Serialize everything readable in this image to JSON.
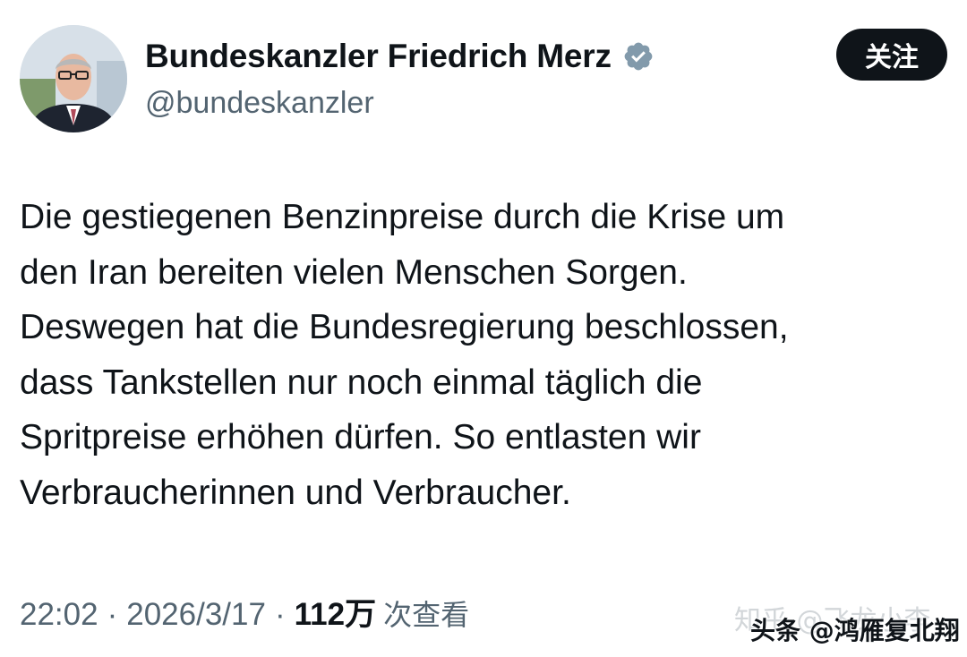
{
  "profile": {
    "display_name": "Bundeskanzler Friedrich Merz",
    "handle": "@bundeskanzler",
    "verified": true,
    "follow_label": "关注"
  },
  "tweet": {
    "lines": [
      "Die gestiegenen Benzinpreise durch die Krise um",
      "den Iran bereiten vielen Menschen Sorgen.",
      "Deswegen hat die Bundesregierung beschlossen,",
      "dass Tankstellen nur noch einmal täglich die",
      "Spritpreise erhöhen dürfen. So entlasten wir",
      "Verbraucherinnen und Verbraucher."
    ]
  },
  "meta": {
    "time": "22:02",
    "separator": "·",
    "date": "2026/3/17",
    "views_count": "112万",
    "views_label": "次查看"
  },
  "watermarks": {
    "zhihu": "知乎 @飞龙小李",
    "toutiao": "头条 @鸿雁复北翔"
  },
  "colors": {
    "text": "#0f1419",
    "secondary": "#536471",
    "follow_bg": "#0f1419",
    "verified_badge": "#829aab"
  }
}
